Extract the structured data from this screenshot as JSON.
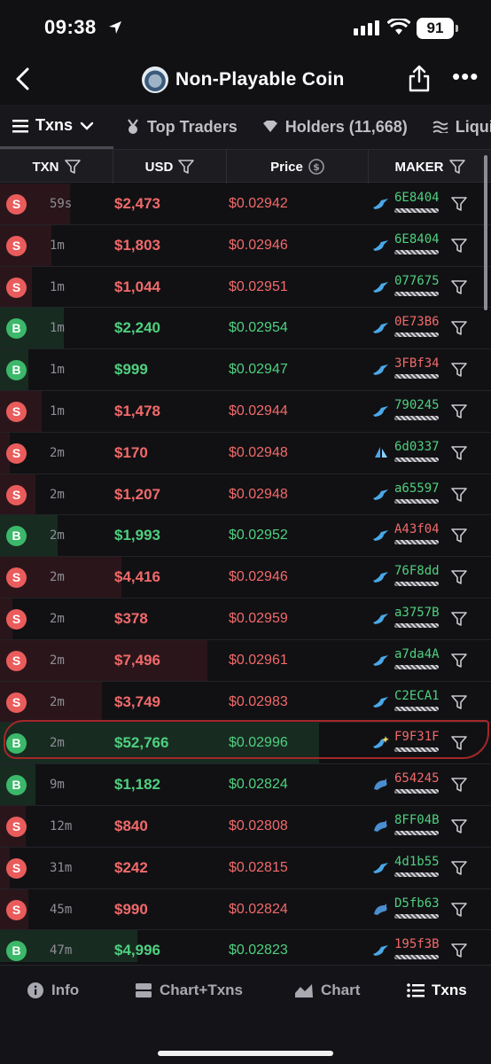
{
  "status_bar": {
    "time": "09:38",
    "battery": "91"
  },
  "header": {
    "title": "Non-Playable Coin"
  },
  "tabs": [
    {
      "label": "Txns",
      "icon": "list-icon",
      "active": true
    },
    {
      "label": "Top Traders",
      "icon": "medal-icon"
    },
    {
      "label": "Holders (11,668)",
      "icon": "heart-icon"
    },
    {
      "label": "Liquidity",
      "icon": "waves-icon"
    }
  ],
  "columns": {
    "txn": "TXN",
    "usd": "USD",
    "price": "Price",
    "maker": "MAKER"
  },
  "rows": [
    {
      "type": "S",
      "age": "59s",
      "usd": "$2,473",
      "price": "$0.02942",
      "maker": "6E8404",
      "maker_icon": "bird-icon",
      "bar": 0.22
    },
    {
      "type": "S",
      "age": "1m",
      "usd": "$1,803",
      "price": "$0.02946",
      "maker": "6E8404",
      "maker_icon": "bird-icon",
      "bar": 0.16
    },
    {
      "type": "S",
      "age": "1m",
      "usd": "$1,044",
      "price": "$0.02951",
      "maker": "077675",
      "maker_icon": "bird-icon",
      "bar": 0.1
    },
    {
      "type": "B",
      "age": "1m",
      "usd": "$2,240",
      "price": "$0.02954",
      "maker": "0E73B6",
      "maker_icon": "bird-icon",
      "bar": 0.2
    },
    {
      "type": "B",
      "age": "1m",
      "usd": "$999",
      "price": "$0.02947",
      "maker": "3FBf34",
      "maker_icon": "bird-icon",
      "bar": 0.09
    },
    {
      "type": "S",
      "age": "1m",
      "usd": "$1,478",
      "price": "$0.02944",
      "maker": "790245",
      "maker_icon": "bird-icon",
      "bar": 0.13
    },
    {
      "type": "S",
      "age": "2m",
      "usd": "$170",
      "price": "$0.02948",
      "maker": "6d0337",
      "maker_icon": "sail-icon",
      "bar": 0.03
    },
    {
      "type": "S",
      "age": "2m",
      "usd": "$1,207",
      "price": "$0.02948",
      "maker": "a65597",
      "maker_icon": "bird-icon",
      "bar": 0.11
    },
    {
      "type": "B",
      "age": "2m",
      "usd": "$1,993",
      "price": "$0.02952",
      "maker": "A43f04",
      "maker_icon": "bird-icon",
      "bar": 0.18
    },
    {
      "type": "S",
      "age": "2m",
      "usd": "$4,416",
      "price": "$0.02946",
      "maker": "76F8dd",
      "maker_icon": "bird-icon",
      "bar": 0.38
    },
    {
      "type": "S",
      "age": "2m",
      "usd": "$378",
      "price": "$0.02959",
      "maker": "a3757B",
      "maker_icon": "bird-icon",
      "bar": 0.04
    },
    {
      "type": "S",
      "age": "2m",
      "usd": "$7,496",
      "price": "$0.02961",
      "maker": "a7da4A",
      "maker_icon": "bird-icon",
      "bar": 0.65
    },
    {
      "type": "S",
      "age": "2m",
      "usd": "$3,749",
      "price": "$0.02983",
      "maker": "C2ECA1",
      "maker_icon": "bird-icon",
      "bar": 0.32
    },
    {
      "type": "B",
      "age": "2m",
      "usd": "$52,766",
      "price": "$0.02996",
      "maker": "F9F31F",
      "maker_icon": "sparkle-bird-icon",
      "bar": 1.0
    },
    {
      "type": "B",
      "age": "9m",
      "usd": "$1,182",
      "price": "$0.02824",
      "maker": "654245",
      "maker_icon": "dolphin-icon",
      "bar": 0.11
    },
    {
      "type": "S",
      "age": "12m",
      "usd": "$840",
      "price": "$0.02808",
      "maker": "8FF04B",
      "maker_icon": "dolphin-icon",
      "bar": 0.08
    },
    {
      "type": "S",
      "age": "31m",
      "usd": "$242",
      "price": "$0.02815",
      "maker": "4d1b55",
      "maker_icon": "bird-icon",
      "bar": 0.03
    },
    {
      "type": "S",
      "age": "45m",
      "usd": "$990",
      "price": "$0.02824",
      "maker": "D5fb63",
      "maker_icon": "dolphin-icon",
      "bar": 0.09
    },
    {
      "type": "B",
      "age": "47m",
      "usd": "$4,996",
      "price": "$0.02823",
      "maker": "195f3B",
      "maker_icon": "bird-icon",
      "bar": 0.43
    }
  ],
  "bottom_nav": [
    {
      "label": "Info",
      "icon": "info-icon"
    },
    {
      "label": "Chart+Txns",
      "icon": "split-icon"
    },
    {
      "label": "Chart",
      "icon": "chart-icon"
    },
    {
      "label": "Txns",
      "icon": "list-icon",
      "active": true
    }
  ],
  "colors": {
    "sell": "#f06a6a",
    "buy": "#4fd07f",
    "background": "#111114",
    "annotation": "#a32828"
  }
}
